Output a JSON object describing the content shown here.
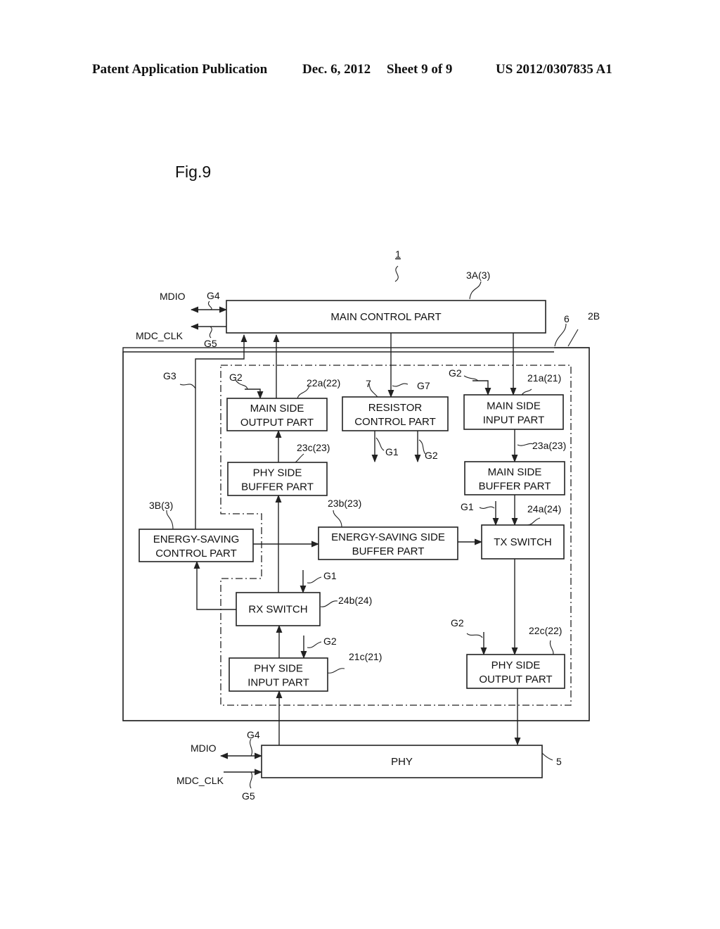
{
  "header": {
    "publication": "Patent Application Publication",
    "date": "Dec. 6, 2012",
    "sheet": "Sheet 9 of 9",
    "number": "US 2012/0307835 A1"
  },
  "figure": {
    "label": "Fig.9",
    "system_ref": "1",
    "boxes": {
      "main_control": {
        "lines": [
          "MAIN CONTROL PART"
        ],
        "ref": "3A(3)"
      },
      "main_side_output": {
        "lines": [
          "MAIN SIDE",
          "OUTPUT PART"
        ],
        "ref": "22a(22)"
      },
      "resistor_control": {
        "lines": [
          "RESISTOR",
          "CONTROL PART"
        ],
        "ref": "7"
      },
      "main_side_input": {
        "lines": [
          "MAIN SIDE",
          "INPUT PART"
        ],
        "ref": "21a(21)"
      },
      "phy_side_buffer": {
        "lines": [
          "PHY SIDE",
          "BUFFER PART"
        ],
        "ref": "23c(23)"
      },
      "main_side_buffer": {
        "lines": [
          "MAIN SIDE",
          "BUFFER PART"
        ],
        "ref": "23a(23)"
      },
      "energy_saving_control": {
        "lines": [
          "ENERGY-SAVING",
          "CONTROL PART"
        ],
        "ref": "3B(3)"
      },
      "energy_saving_buffer": {
        "lines": [
          "ENERGY-SAVING  SIDE",
          "BUFFER PART"
        ],
        "ref": "23b(23)"
      },
      "tx_switch": {
        "lines": [
          "TX SWITCH"
        ],
        "ref": "24a(24)"
      },
      "rx_switch": {
        "lines": [
          "RX SWITCH"
        ],
        "ref": "24b(24)"
      },
      "phy_side_input": {
        "lines": [
          "PHY SIDE",
          "INPUT PART"
        ],
        "ref": "21c(21)"
      },
      "phy_side_output": {
        "lines": [
          "PHY SIDE",
          "OUTPUT PART"
        ],
        "ref": "22c(22)"
      },
      "phy": {
        "lines": [
          "PHY"
        ],
        "ref": "5"
      }
    },
    "frame_refs": {
      "outer": "6",
      "dashed": "2B"
    },
    "signals": {
      "mdio": "MDIO",
      "mdc_clk": "MDC_CLK",
      "g1": "G1",
      "g2": "G2",
      "g3": "G3",
      "g4": "G4",
      "g5": "G5",
      "g7": "G7"
    }
  }
}
